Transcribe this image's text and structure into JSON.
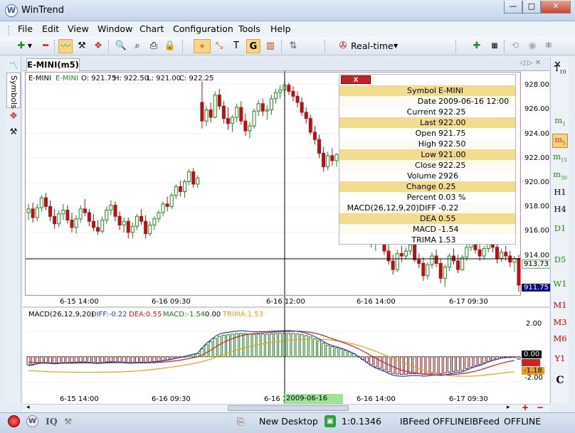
{
  "window": {
    "title": "WinTrend",
    "buttons": [
      "—",
      "□",
      "✕"
    ]
  },
  "menu": [
    "File",
    "Edit",
    "View",
    "Window",
    "Chart",
    "Configuration",
    "Tools",
    "Help"
  ],
  "toolbar": {
    "realtime": "Real-time"
  },
  "tab": {
    "label": "E-MINI(m5)",
    "nav": "◁ ▷ ✕"
  },
  "left_panel": {
    "symbols": "Symbols"
  },
  "timeframes": [
    "T10",
    "m1",
    "m5",
    "m15",
    "m30",
    "H1",
    "H4",
    "D1",
    "D5",
    "W1",
    "M1",
    "M3",
    "M6",
    "Y1",
    "C"
  ],
  "price_header": {
    "symbol": "E-MINI",
    "sym2": "E-MINI",
    "o": "O: 921.75",
    "h": "H: 922.50",
    "l": "L: 921.00",
    "c": "C: 922.25"
  },
  "price_axis": [
    "928.00",
    "926.00",
    "924.00",
    "922.00",
    "920.00",
    "918.00",
    "916.00",
    "914.00"
  ],
  "price_tags": {
    "cursor": "913.73",
    "last": "911.75"
  },
  "time_axis": [
    "6-15 14:00",
    "6-16 09:30",
    "6-16 12:00",
    "6-16 14:00",
    "6-17 09:30"
  ],
  "macd_header": {
    "name": "MACD(26,12,9,20)",
    "diff": "DIFF:-0.22",
    "dea": "DEA:0.55",
    "macd": "MACD:-1.54",
    "zero": "0.00",
    "trima": "TRIMA:1.53"
  },
  "macd_axis": [
    "2.00",
    "-2.00"
  ],
  "macd_tags": {
    "zero": "0.00",
    "trima": "-1.18"
  },
  "macd_time_axis": [
    "6-15 14:00",
    "6-16 09:30",
    "6-16 1",
    "6-16 14:00",
    "6-17 09:30"
  ],
  "cursor_date": "2009-06-16 12:00",
  "info": {
    "close_label": "X",
    "rows": [
      {
        "k": "Symbol",
        "v": "E-MINI"
      },
      {
        "k": "Date",
        "v": "2009-06-16 12:00"
      },
      {
        "k": "Current",
        "v": "922.25"
      },
      {
        "k": "Last",
        "v": "922.00"
      },
      {
        "k": "Open",
        "v": "921.75"
      },
      {
        "k": "High",
        "v": "922.50"
      },
      {
        "k": "Low",
        "v": "921.00"
      },
      {
        "k": "Close",
        "v": "922.25"
      },
      {
        "k": "Volume",
        "v": "2926"
      },
      {
        "k": "Change",
        "v": "0.25"
      },
      {
        "k": "Percent",
        "v": "0.03 %"
      },
      {
        "k": "MACD(26,12,9,20)DIFF",
        "v": "-0.22"
      },
      {
        "k": "DEA",
        "v": "0.55"
      },
      {
        "k": "MACD",
        "v": "-1.54"
      },
      {
        "k": "TRIMA",
        "v": "1.53"
      }
    ]
  },
  "status": {
    "iq": "IQ",
    "desktop": "New Desktop",
    "ratio": "1:0.1346",
    "feed1": "IBFeed",
    "state1": "OFFLINE",
    "feed2": "IBFeed",
    "state2": "OFFLINE"
  },
  "colors": {
    "up": "#1f8a1f",
    "down": "#b01515",
    "diff": "#2040c0",
    "dea": "#d02020",
    "trima": "#e8a020",
    "hist_up": "#1e7a1e",
    "hist_dn": "#7a1e1e",
    "highlight": "#f2dd8c"
  },
  "chart_data": [
    {
      "type": "candlestick",
      "title": "E-MINI(m5)",
      "ylim": [
        911,
        928.8
      ],
      "x_labels": [
        "6-15 14:00",
        "6-16 09:30",
        "6-16 12:00",
        "6-16 14:00",
        "6-17 09:30"
      ],
      "values": [
        [
          917.6,
          918.3,
          917.0,
          917.9
        ],
        [
          917.9,
          918.4,
          916.8,
          917.2
        ],
        [
          917.2,
          918.3,
          916.9,
          918.0
        ],
        [
          918.0,
          919.0,
          917.7,
          918.8
        ],
        [
          918.8,
          919.2,
          917.8,
          918.1
        ],
        [
          918.1,
          918.6,
          916.9,
          917.3
        ],
        [
          917.3,
          917.9,
          916.3,
          916.7
        ],
        [
          916.7,
          917.8,
          916.4,
          917.5
        ],
        [
          917.5,
          918.3,
          917.0,
          917.8
        ],
        [
          917.8,
          918.2,
          916.7,
          917.0
        ],
        [
          917.0,
          917.6,
          916.0,
          916.4
        ],
        [
          916.4,
          917.4,
          915.9,
          917.1
        ],
        [
          917.1,
          918.2,
          916.8,
          917.9
        ],
        [
          917.9,
          918.7,
          917.3,
          917.6
        ],
        [
          917.6,
          917.9,
          916.5,
          916.9
        ],
        [
          916.9,
          917.5,
          916.1,
          916.4
        ],
        [
          916.4,
          917.0,
          915.8,
          916.1
        ],
        [
          916.1,
          917.3,
          915.9,
          917.0
        ],
        [
          917.0,
          918.1,
          916.7,
          917.8
        ],
        [
          917.8,
          918.6,
          917.4,
          918.2
        ],
        [
          918.2,
          918.5,
          916.9,
          917.3
        ],
        [
          917.3,
          917.7,
          916.2,
          916.6
        ],
        [
          916.6,
          917.2,
          916.0,
          916.9
        ],
        [
          916.9,
          917.2,
          915.5,
          916.0
        ],
        [
          916.0,
          916.8,
          915.5,
          916.5
        ],
        [
          916.5,
          917.5,
          916.2,
          917.3
        ],
        [
          917.3,
          917.9,
          916.6,
          916.9
        ],
        [
          916.9,
          917.4,
          915.5,
          915.9
        ],
        [
          915.9,
          916.9,
          915.7,
          916.6
        ],
        [
          916.6,
          917.3,
          916.2,
          917.1
        ],
        [
          917.1,
          917.8,
          916.8,
          917.6
        ],
        [
          917.6,
          918.5,
          917.3,
          918.3
        ],
        [
          918.3,
          918.9,
          917.7,
          918.1
        ],
        [
          918.1,
          919.2,
          917.9,
          919.0
        ],
        [
          919.0,
          919.9,
          918.7,
          919.7
        ],
        [
          919.7,
          920.2,
          918.9,
          919.3
        ],
        [
          919.3,
          920.3,
          918.8,
          920.1
        ],
        [
          920.1,
          921.1,
          919.8,
          920.9
        ],
        [
          920.9,
          921.2,
          919.6,
          919.9
        ],
        [
          919.9,
          920.6,
          919.6,
          920.4
        ],
        [
          926.5,
          928.2,
          924.4,
          925.0
        ],
        [
          925.0,
          926.2,
          924.6,
          925.9
        ],
        [
          925.9,
          926.5,
          924.9,
          925.3
        ],
        [
          925.3,
          927.4,
          925.2,
          927.1
        ],
        [
          927.1,
          927.6,
          925.9,
          926.2
        ],
        [
          926.2,
          926.6,
          924.8,
          925.2
        ],
        [
          925.2,
          926.1,
          924.3,
          924.8
        ],
        [
          924.8,
          925.5,
          924.1,
          925.3
        ],
        [
          925.3,
          926.4,
          924.9,
          926.1
        ],
        [
          926.1,
          926.6,
          924.7,
          925.0
        ],
        [
          925.0,
          925.6,
          923.8,
          924.2
        ],
        [
          924.2,
          924.9,
          923.6,
          924.6
        ],
        [
          924.6,
          926.0,
          924.4,
          925.8
        ],
        [
          925.8,
          926.7,
          925.4,
          926.4
        ],
        [
          926.4,
          926.8,
          925.4,
          925.8
        ],
        [
          925.8,
          926.3,
          925.1,
          925.9
        ],
        [
          925.9,
          927.1,
          925.5,
          926.8
        ],
        [
          926.8,
          927.6,
          926.4,
          927.3
        ],
        [
          927.3,
          927.9,
          926.8,
          927.5
        ],
        [
          927.5,
          928.2,
          927.0,
          927.9
        ],
        [
          927.9,
          928.1,
          927.1,
          927.4
        ],
        [
          927.4,
          927.8,
          926.6,
          927.0
        ],
        [
          927.0,
          927.4,
          926.1,
          926.5
        ],
        [
          926.5,
          926.9,
          925.4,
          925.7
        ],
        [
          925.7,
          926.1,
          924.8,
          925.2
        ],
        [
          925.2,
          925.5,
          923.9,
          924.1
        ],
        [
          924.1,
          924.6,
          923.1,
          923.5
        ],
        [
          923.5,
          923.9,
          922.0,
          922.4
        ],
        [
          922.4,
          922.9,
          920.9,
          921.3
        ],
        [
          921.3,
          922.5,
          921.0,
          922.2
        ],
        [
          922.2,
          922.8,
          921.4,
          921.8
        ],
        [
          921.8,
          922.4,
          921.3,
          922.3
        ],
        [
          922.3,
          922.9,
          921.7,
          922.1
        ],
        [
          922.1,
          922.6,
          920.8,
          921.1
        ],
        [
          921.1,
          921.7,
          920.2,
          920.6
        ],
        [
          920.6,
          921.2,
          919.6,
          919.9
        ],
        [
          919.9,
          920.5,
          917.9,
          918.3
        ],
        [
          918.3,
          918.8,
          916.5,
          916.8
        ],
        [
          916.8,
          917.6,
          915.9,
          916.3
        ],
        [
          916.3,
          916.8,
          914.8,
          915.1
        ],
        [
          915.1,
          916.2,
          914.5,
          915.9
        ],
        [
          915.9,
          916.4,
          915.1,
          915.4
        ],
        [
          915.4,
          915.9,
          914.2,
          914.5
        ],
        [
          914.5,
          915.0,
          913.4,
          913.7
        ],
        [
          913.7,
          914.2,
          912.6,
          913.0
        ],
        [
          913.0,
          914.6,
          912.8,
          914.3
        ],
        [
          914.3,
          914.9,
          913.6,
          914.1
        ],
        [
          914.1,
          914.8,
          913.8,
          914.5
        ],
        [
          914.5,
          915.3,
          914.2,
          915.0
        ],
        [
          915.0,
          915.1,
          913.6,
          913.8
        ],
        [
          913.8,
          914.3,
          913.1,
          913.5
        ],
        [
          913.5,
          914.0,
          912.1,
          912.5
        ],
        [
          912.5,
          913.6,
          912.2,
          913.4
        ],
        [
          913.4,
          914.4,
          913.1,
          914.1
        ],
        [
          914.1,
          914.6,
          913.2,
          913.5
        ],
        [
          913.5,
          913.9,
          911.9,
          912.3
        ],
        [
          912.3,
          913.4,
          911.6,
          913.2
        ],
        [
          913.2,
          914.3,
          912.9,
          914.1
        ],
        [
          914.1,
          914.7,
          913.4,
          913.7
        ],
        [
          913.7,
          914.2,
          912.7,
          913.0
        ],
        [
          913.0,
          914.2,
          912.9,
          914.0
        ],
        [
          914.0,
          915.1,
          913.7,
          914.8
        ],
        [
          914.8,
          915.6,
          914.5,
          915.3
        ],
        [
          915.3,
          915.6,
          914.3,
          914.6
        ],
        [
          914.6,
          915.0,
          913.7,
          914.1
        ],
        [
          914.1,
          914.9,
          913.8,
          914.7
        ],
        [
          914.7,
          915.5,
          914.4,
          915.2
        ],
        [
          915.2,
          915.6,
          914.4,
          914.8
        ],
        [
          914.8,
          915.1,
          913.5,
          913.9
        ],
        [
          913.9,
          914.7,
          913.6,
          914.4
        ],
        [
          914.4,
          914.9,
          913.7,
          914.1
        ],
        [
          914.1,
          914.5,
          913.2,
          913.6
        ],
        [
          913.6,
          914.1,
          912.8,
          913.9
        ],
        [
          913.9,
          914.2,
          911.2,
          911.75
        ]
      ]
    },
    {
      "type": "macd",
      "name": "MACD(26,12,9,20)",
      "ylim": [
        -2.8,
        3.0
      ],
      "series": [
        {
          "name": "DIFF"
        },
        {
          "name": "DEA"
        },
        {
          "name": "MACD"
        },
        {
          "name": "TRIMA"
        }
      ],
      "x_labels": [
        "6-15 14:00",
        "6-16 09:30",
        "6-16 1",
        "6-16 14:00",
        "6-17 09:30"
      ],
      "diff": [
        -0.7,
        -0.65,
        -0.55,
        -0.5,
        -0.5,
        -0.52,
        -0.55,
        -0.53,
        -0.5,
        -0.5,
        -0.48,
        -0.47,
        -0.45,
        -0.46,
        -0.48,
        -0.5,
        -0.52,
        -0.5,
        -0.45,
        -0.42,
        -0.43,
        -0.45,
        -0.47,
        -0.5,
        -0.5,
        -0.48,
        -0.47,
        -0.48,
        -0.46,
        -0.42,
        -0.38,
        -0.33,
        -0.27,
        -0.2,
        -0.12,
        -0.05,
        0.03,
        0.12,
        0.2,
        0.28,
        0.7,
        1.05,
        1.32,
        1.6,
        1.78,
        1.88,
        1.92,
        1.97,
        2.02,
        2.04,
        2.02,
        1.98,
        1.96,
        1.97,
        1.98,
        1.98,
        2.0,
        2.02,
        2.04,
        2.05,
        2.05,
        2.03,
        1.99,
        1.93,
        1.85,
        1.73,
        1.58,
        1.4,
        1.18,
        1.02,
        0.88,
        0.78,
        0.68,
        0.56,
        0.42,
        0.26,
        0.04,
        -0.22,
        -0.45,
        -0.7,
        -0.88,
        -1.0,
        -1.15,
        -1.3,
        -1.45,
        -1.5,
        -1.53,
        -1.52,
        -1.48,
        -1.48,
        -1.48,
        -1.52,
        -1.5,
        -1.45,
        -1.43,
        -1.46,
        -1.42,
        -1.35,
        -1.28,
        -1.25,
        -1.18,
        -1.05,
        -0.9,
        -0.78,
        -0.68,
        -0.55,
        -0.4,
        -0.28,
        -0.2,
        -0.1,
        -0.06,
        -0.05,
        0.0,
        -0.2
      ],
      "dea": [
        -0.4,
        -0.44,
        -0.46,
        -0.47,
        -0.48,
        -0.49,
        -0.5,
        -0.5,
        -0.5,
        -0.5,
        -0.5,
        -0.49,
        -0.48,
        -0.48,
        -0.48,
        -0.48,
        -0.49,
        -0.49,
        -0.48,
        -0.47,
        -0.46,
        -0.46,
        -0.46,
        -0.47,
        -0.47,
        -0.47,
        -0.47,
        -0.47,
        -0.47,
        -0.46,
        -0.44,
        -0.42,
        -0.39,
        -0.35,
        -0.31,
        -0.26,
        -0.2,
        -0.14,
        -0.07,
        0.0,
        0.14,
        0.32,
        0.52,
        0.74,
        0.95,
        1.14,
        1.29,
        1.43,
        1.55,
        1.65,
        1.73,
        1.78,
        1.82,
        1.85,
        1.88,
        1.9,
        1.92,
        1.94,
        1.96,
        1.98,
        1.99,
        2.0,
        2.0,
        1.99,
        1.96,
        1.92,
        1.85,
        1.77,
        1.66,
        1.54,
        1.42,
        1.3,
        1.18,
        1.06,
        0.93,
        0.79,
        0.63,
        0.46,
        0.28,
        0.08,
        -0.1,
        -0.28,
        -0.45,
        -0.62,
        -0.78,
        -0.92,
        -1.04,
        -1.14,
        -1.21,
        -1.27,
        -1.31,
        -1.35,
        -1.38,
        -1.4,
        -1.41,
        -1.42,
        -1.42,
        -1.41,
        -1.38,
        -1.36,
        -1.32,
        -1.27,
        -1.2,
        -1.12,
        -1.03,
        -0.93,
        -0.82,
        -0.71,
        -0.61,
        -0.51,
        -0.42,
        -0.35,
        -0.28,
        0.55
      ],
      "trima": [
        -1.1,
        -1.1,
        -1.12,
        -1.14,
        -1.15,
        -1.17,
        -1.18,
        -1.19,
        -1.2,
        -1.2,
        -1.21,
        -1.21,
        -1.22,
        -1.22,
        -1.22,
        -1.22,
        -1.21,
        -1.21,
        -1.2,
        -1.2,
        -1.19,
        -1.18,
        -1.17,
        -1.15,
        -1.13,
        -1.11,
        -1.08,
        -1.05,
        -1.02,
        -0.98,
        -0.94,
        -0.9,
        -0.86,
        -0.81,
        -0.76,
        -0.71,
        -0.65,
        -0.59,
        -0.53,
        -0.46,
        -0.38,
        -0.28,
        -0.18,
        -0.06,
        0.06,
        0.18,
        0.3,
        0.42,
        0.53,
        0.63,
        0.72,
        0.8,
        0.88,
        0.95,
        1.02,
        1.08,
        1.13,
        1.18,
        1.22,
        1.26,
        1.3,
        1.32,
        1.34,
        1.36,
        1.37,
        1.38,
        1.38,
        1.37,
        1.36,
        1.34,
        1.3,
        1.26,
        1.21,
        1.15,
        1.08,
        1.0,
        0.9,
        0.8,
        0.68,
        0.56,
        0.43,
        0.3,
        0.16,
        0.02,
        -0.12,
        -0.26,
        -0.4,
        -0.54,
        -0.67,
        -0.8,
        -0.93,
        -1.04,
        -1.14,
        -1.23,
        -1.31,
        -1.38,
        -1.43,
        -1.47,
        -1.5,
        -1.52,
        -1.53,
        -1.53,
        -1.52,
        -1.5,
        -1.47,
        -1.44,
        -1.4,
        -1.36,
        -1.32,
        -1.28,
        -1.24,
        -1.2,
        -1.18,
        1.53
      ]
    }
  ]
}
